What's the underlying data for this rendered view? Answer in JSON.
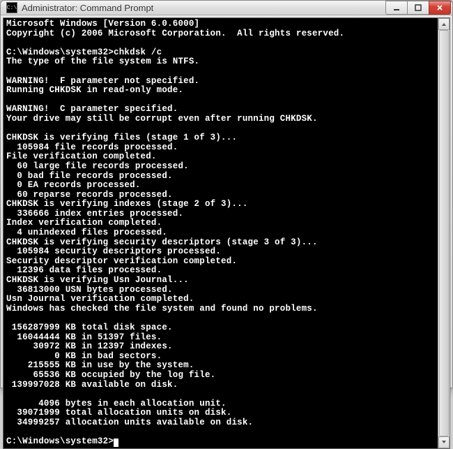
{
  "window": {
    "title": "Administrator: Command Prompt",
    "icon_label": "C:\\"
  },
  "console": {
    "lines": [
      "Microsoft Windows [Version 6.0.6000]",
      "Copyright (c) 2006 Microsoft Corporation.  All rights reserved.",
      "",
      "C:\\Windows\\system32>chkdsk /c",
      "The type of the file system is NTFS.",
      "",
      "WARNING!  F parameter not specified.",
      "Running CHKDSK in read-only mode.",
      "",
      "WARNING!  C parameter specified.",
      "Your drive may still be corrupt even after running CHKDSK.",
      "",
      "CHKDSK is verifying files (stage 1 of 3)...",
      "  105984 file records processed.",
      "File verification completed.",
      "  60 large file records processed.",
      "  0 bad file records processed.",
      "  0 EA records processed.",
      "  60 reparse records processed.",
      "CHKDSK is verifying indexes (stage 2 of 3)...",
      "  336666 index entries processed.",
      "Index verification completed.",
      "  4 unindexed files processed.",
      "CHKDSK is verifying security descriptors (stage 3 of 3)...",
      "  105984 security descriptors processed.",
      "Security descriptor verification completed.",
      "  12396 data files processed.",
      "CHKDSK is verifying Usn Journal...",
      "  36813000 USN bytes processed.",
      "Usn Journal verification completed.",
      "Windows has checked the file system and found no problems.",
      "",
      " 156287999 KB total disk space.",
      "  16044444 KB in 51397 files.",
      "     30972 KB in 12397 indexes.",
      "         0 KB in bad sectors.",
      "    215555 KB in use by the system.",
      "     65536 KB occupied by the log file.",
      " 139997028 KB available on disk.",
      "",
      "      4096 bytes in each allocation unit.",
      "  39071999 total allocation units on disk.",
      "  34999257 allocation units available on disk.",
      ""
    ],
    "prompt": "C:\\Windows\\system32>"
  }
}
